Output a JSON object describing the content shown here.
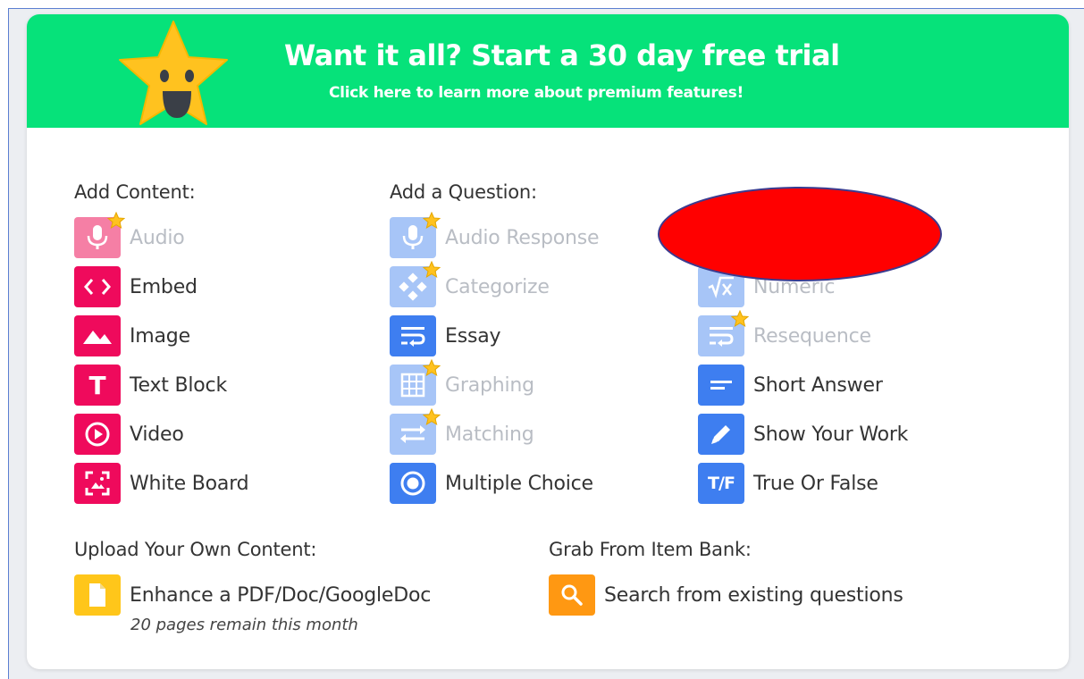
{
  "banner": {
    "title": "Want it all? Start a 30 day free trial",
    "subtitle": "Click here to learn more about premium features!"
  },
  "add_content": {
    "heading": "Add Content:",
    "items": [
      {
        "label": "Audio",
        "icon": "microphone-icon",
        "premium": true
      },
      {
        "label": "Embed",
        "icon": "code-icon",
        "premium": false
      },
      {
        "label": "Image",
        "icon": "mountains-icon",
        "premium": false
      },
      {
        "label": "Text Block",
        "icon": "text-t-icon",
        "premium": false
      },
      {
        "label": "Video",
        "icon": "play-icon",
        "premium": false
      },
      {
        "label": "White Board",
        "icon": "whiteboard-icon",
        "premium": false
      }
    ]
  },
  "add_question": {
    "heading": "Add a Question:",
    "col1": [
      {
        "label": "Audio Response",
        "icon": "microphone-icon",
        "premium": true
      },
      {
        "label": "Categorize",
        "icon": "categorize-icon",
        "premium": true
      },
      {
        "label": "Essay",
        "icon": "wrap-text-icon",
        "premium": false
      },
      {
        "label": "Graphing",
        "icon": "grid-icon",
        "premium": true
      },
      {
        "label": "Matching",
        "icon": "swap-arrows-icon",
        "premium": true
      },
      {
        "label": "Multiple Choice",
        "icon": "radio-icon",
        "premium": false
      }
    ],
    "col2": [
      {
        "label": "Numeric",
        "icon": "sqrt-x-icon",
        "premium": true
      },
      {
        "label": "Resequence",
        "icon": "wrap-text-icon",
        "premium": true
      },
      {
        "label": "Short Answer",
        "icon": "short-lines-icon",
        "premium": false
      },
      {
        "label": "Show Your Work",
        "icon": "pencil-icon",
        "premium": false
      },
      {
        "label": "True Or False",
        "icon": "true-false-icon",
        "premium": false,
        "icon_text": "T/F"
      }
    ]
  },
  "upload": {
    "heading": "Upload Your Own Content:",
    "item_label": "Enhance a PDF/Doc/GoogleDoc",
    "note": "20 pages remain this month"
  },
  "item_bank": {
    "heading": "Grab From Item Bank:",
    "item_label": "Search from existing questions"
  },
  "colors": {
    "banner": "#06e27a",
    "content_icon": "#ef0a5c",
    "question_icon": "#3e7ef0",
    "premium_question_icon": "#a7c5f7",
    "upload_icon": "#ffc61a",
    "search_icon_bg": "#ff9812",
    "redaction": "#ff0000"
  }
}
